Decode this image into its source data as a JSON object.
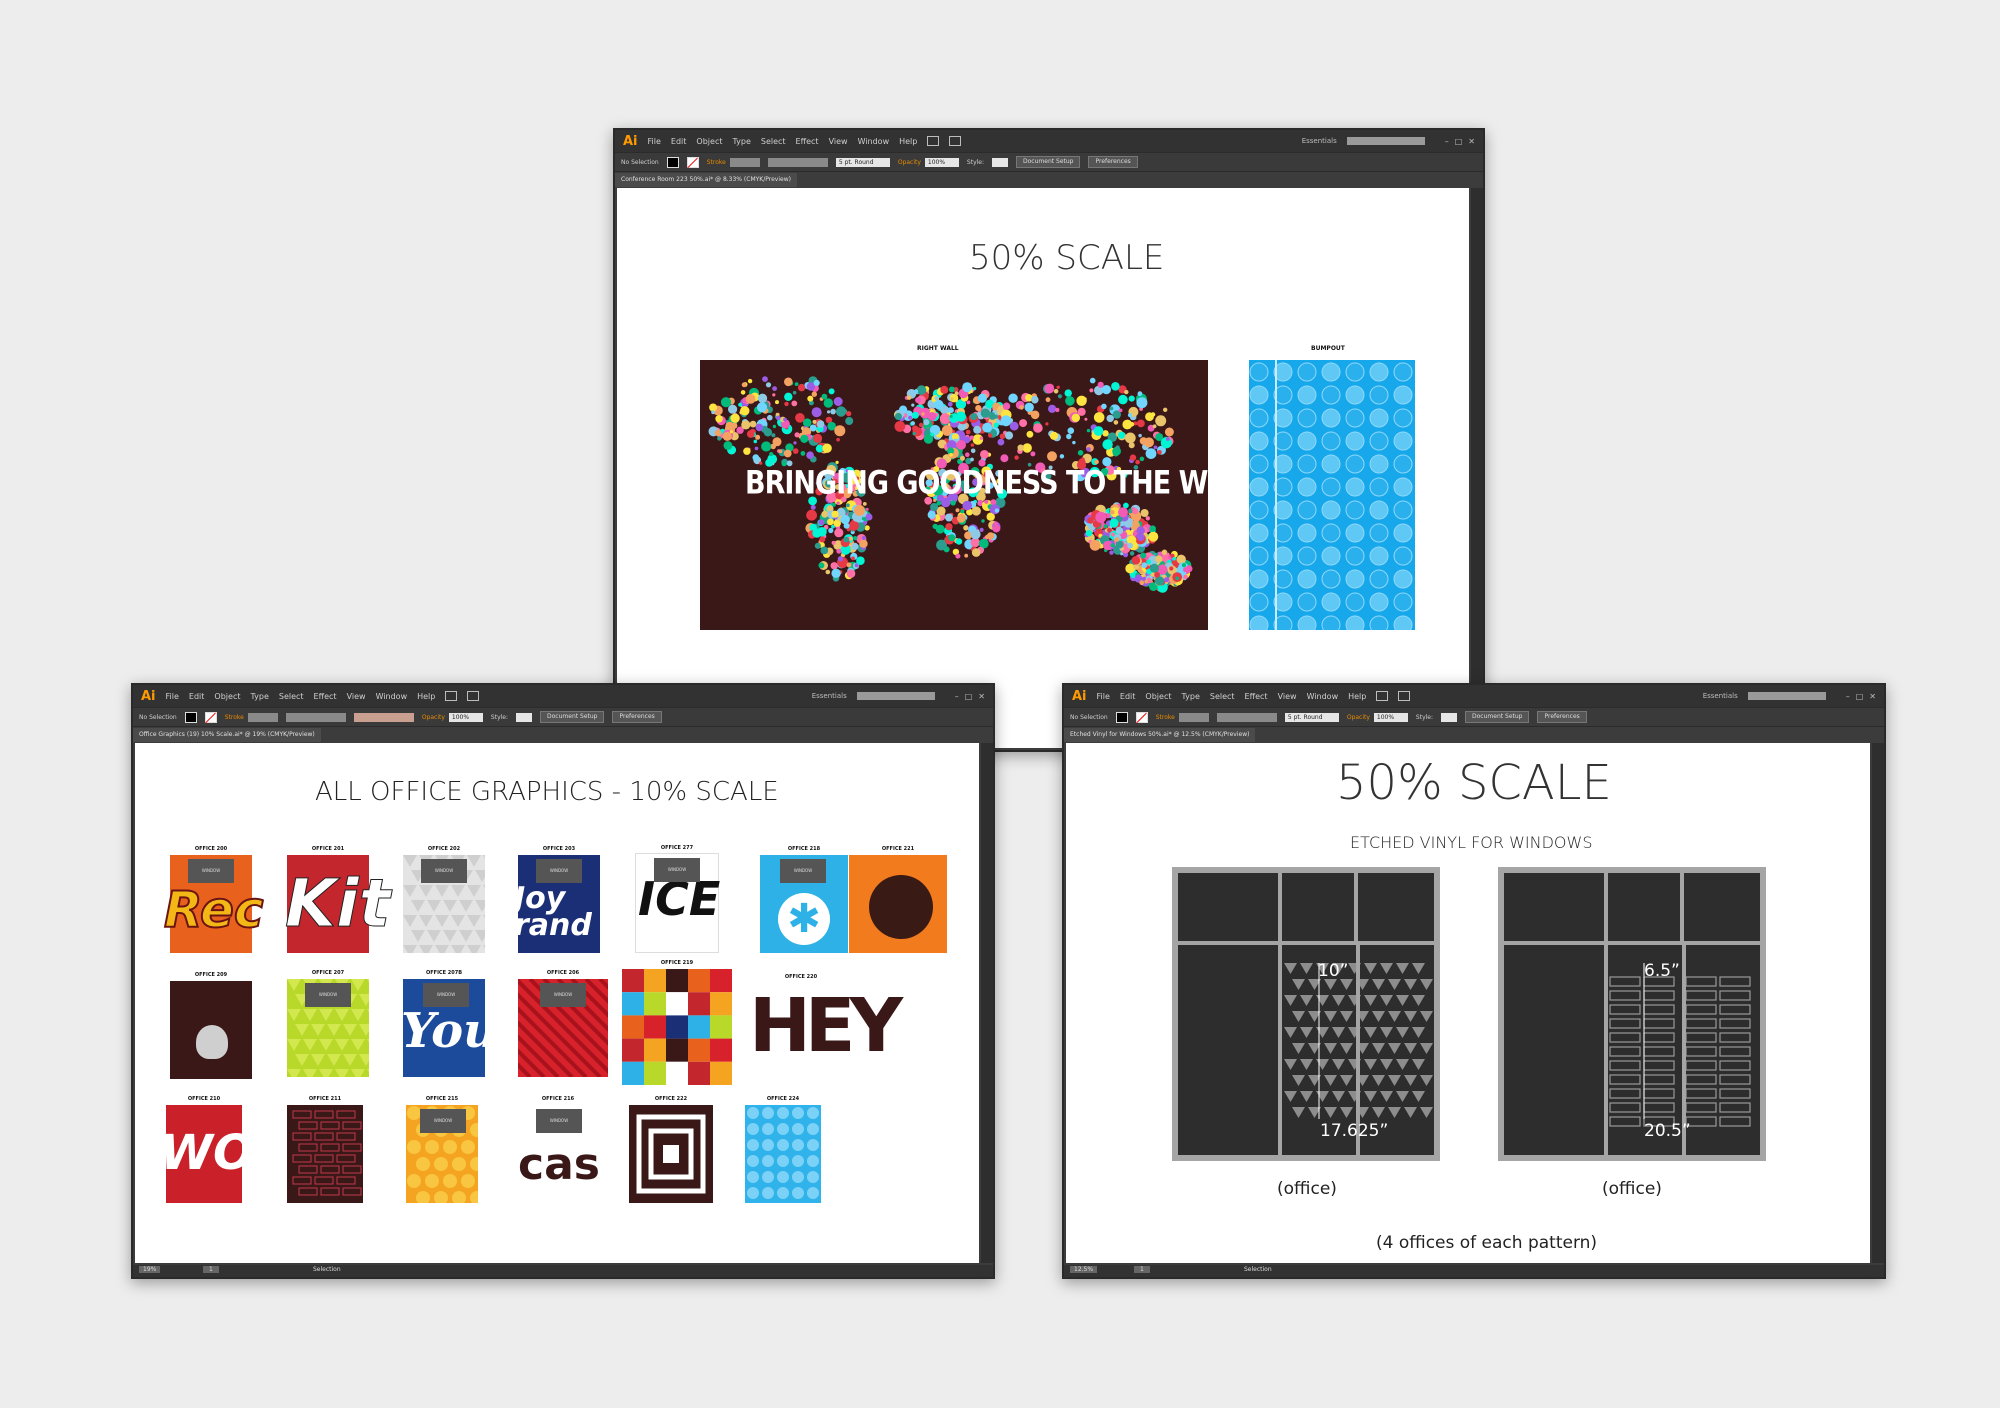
{
  "menu": [
    "File",
    "Edit",
    "Object",
    "Type",
    "Select",
    "Effect",
    "View",
    "Window",
    "Help"
  ],
  "app_logo": "Ai",
  "workspace": "Essentials",
  "control": {
    "no_selection": "No Selection",
    "stroke": "Stroke",
    "brush": "5 pt. Round",
    "opacity": "Opacity",
    "opacity_value": "100%",
    "style": "Style:",
    "document_setup": "Document Setup",
    "preferences": "Preferences"
  },
  "window_top": {
    "tab": "Conference Room 223 50%.ai* @ 8.33% (CMYK/Preview)",
    "title": "50% SCALE",
    "right_wall_label": "RIGHT WALL",
    "bumpout_label": "BUMPOUT",
    "map_text": "BRINGING GOODNESS TO THE WORLD"
  },
  "window_left": {
    "tab": "Office Graphics (19) 10% Scale.ai* @ 19% (CMYK/Preview)",
    "title": "ALL OFFICE GRAPHICS - 10% SCALE",
    "window_label": "WINDOW",
    "tiles": [
      {
        "label": "OFFICE 200",
        "art": "Rec"
      },
      {
        "label": "OFFICE 201",
        "art": "Kit"
      },
      {
        "label": "OFFICE 202",
        "art": ""
      },
      {
        "label": "OFFICE 203",
        "art": "Joy rand"
      },
      {
        "label": "OFFICE 277",
        "art": "ICE"
      },
      {
        "label": "OFFICE 218",
        "art": ""
      },
      {
        "label": "OFFICE 221",
        "art": ""
      },
      {
        "label": "OFFICE 209",
        "art": ""
      },
      {
        "label": "OFFICE 207",
        "art": ""
      },
      {
        "label": "OFFICE 207B",
        "art": "You"
      },
      {
        "label": "OFFICE 206",
        "art": ""
      },
      {
        "label": "OFFICE 219",
        "art": ""
      },
      {
        "label": "OFFICE 220",
        "art": "HEY"
      },
      {
        "label": "OFFICE 210",
        "art": "WO"
      },
      {
        "label": "OFFICE 211",
        "art": ""
      },
      {
        "label": "OFFICE 215",
        "art": ""
      },
      {
        "label": "OFFICE 216",
        "art": "cas"
      },
      {
        "label": "OFFICE 222",
        "art": ""
      },
      {
        "label": "OFFICE 224",
        "art": ""
      }
    ],
    "status": {
      "zoom": "19%",
      "page": "1",
      "tool": "Selection"
    }
  },
  "window_right": {
    "tab": "Etched Vinyl for Windows 50%.ai* @ 12.5% (CMYK/Preview)",
    "title": "50% SCALE",
    "subtitle": "ETCHED VINYL FOR WINDOWS",
    "left_dim_top": "10”",
    "left_dim_bottom": "17.625”",
    "right_dim_top": "6.5”",
    "right_dim_bottom": "20.5”",
    "caption_office": "(office)",
    "footer": "(4 offices of each pattern)",
    "status": {
      "zoom": "12.5%",
      "page": "1",
      "tool": "Selection"
    }
  }
}
